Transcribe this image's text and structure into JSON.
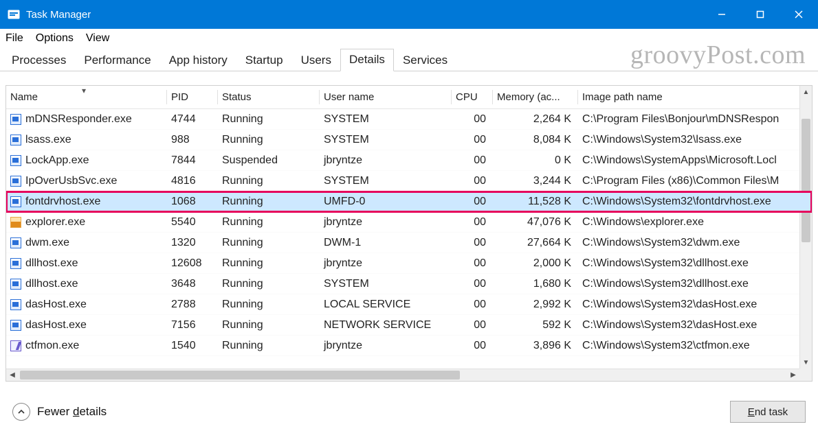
{
  "window": {
    "title": "Task Manager"
  },
  "menu": {
    "items": [
      "File",
      "Options",
      "View"
    ]
  },
  "tabs": {
    "items": [
      "Processes",
      "Performance",
      "App history",
      "Startup",
      "Users",
      "Details",
      "Services"
    ],
    "active_index": 5
  },
  "watermark": "groovyPost.com",
  "columns": {
    "name": "Name",
    "pid": "PID",
    "status": "Status",
    "user": "User name",
    "cpu": "CPU",
    "mem": "Memory (ac...",
    "path": "Image path name"
  },
  "rows": [
    {
      "name": "mDNSResponder.exe",
      "pid": "4744",
      "status": "Running",
      "user": "SYSTEM",
      "cpu": "00",
      "mem": "2,264 K",
      "path": "C:\\Program Files\\Bonjour\\mDNSRespon",
      "icon": "app"
    },
    {
      "name": "lsass.exe",
      "pid": "988",
      "status": "Running",
      "user": "SYSTEM",
      "cpu": "00",
      "mem": "8,084 K",
      "path": "C:\\Windows\\System32\\lsass.exe",
      "icon": "app"
    },
    {
      "name": "LockApp.exe",
      "pid": "7844",
      "status": "Suspended",
      "user": "jbryntze",
      "cpu": "00",
      "mem": "0 K",
      "path": "C:\\Windows\\SystemApps\\Microsoft.Locl",
      "icon": "app"
    },
    {
      "name": "IpOverUsbSvc.exe",
      "pid": "4816",
      "status": "Running",
      "user": "SYSTEM",
      "cpu": "00",
      "mem": "3,244 K",
      "path": "C:\\Program Files (x86)\\Common Files\\M",
      "icon": "app"
    },
    {
      "name": "fontdrvhost.exe",
      "pid": "1068",
      "status": "Running",
      "user": "UMFD-0",
      "cpu": "00",
      "mem": "11,528 K",
      "path": "C:\\Windows\\System32\\fontdrvhost.exe",
      "icon": "app",
      "selected": true,
      "highlight": true
    },
    {
      "name": "explorer.exe",
      "pid": "5540",
      "status": "Running",
      "user": "jbryntze",
      "cpu": "00",
      "mem": "47,076 K",
      "path": "C:\\Windows\\explorer.exe",
      "icon": "explorer"
    },
    {
      "name": "dwm.exe",
      "pid": "1320",
      "status": "Running",
      "user": "DWM-1",
      "cpu": "00",
      "mem": "27,664 K",
      "path": "C:\\Windows\\System32\\dwm.exe",
      "icon": "app"
    },
    {
      "name": "dllhost.exe",
      "pid": "12608",
      "status": "Running",
      "user": "jbryntze",
      "cpu": "00",
      "mem": "2,000 K",
      "path": "C:\\Windows\\System32\\dllhost.exe",
      "icon": "app"
    },
    {
      "name": "dllhost.exe",
      "pid": "3648",
      "status": "Running",
      "user": "SYSTEM",
      "cpu": "00",
      "mem": "1,680 K",
      "path": "C:\\Windows\\System32\\dllhost.exe",
      "icon": "app"
    },
    {
      "name": "dasHost.exe",
      "pid": "2788",
      "status": "Running",
      "user": "LOCAL SERVICE",
      "cpu": "00",
      "mem": "2,992 K",
      "path": "C:\\Windows\\System32\\dasHost.exe",
      "icon": "app"
    },
    {
      "name": "dasHost.exe",
      "pid": "7156",
      "status": "Running",
      "user": "NETWORK SERVICE",
      "cpu": "00",
      "mem": "592 K",
      "path": "C:\\Windows\\System32\\dasHost.exe",
      "icon": "app"
    },
    {
      "name": "ctfmon.exe",
      "pid": "1540",
      "status": "Running",
      "user": "jbryntze",
      "cpu": "00",
      "mem": "3,896 K",
      "path": "C:\\Windows\\System32\\ctfmon.exe",
      "icon": "ctfmon"
    }
  ],
  "footer": {
    "fewer_details": "Fewer details",
    "end_task": "End task"
  }
}
